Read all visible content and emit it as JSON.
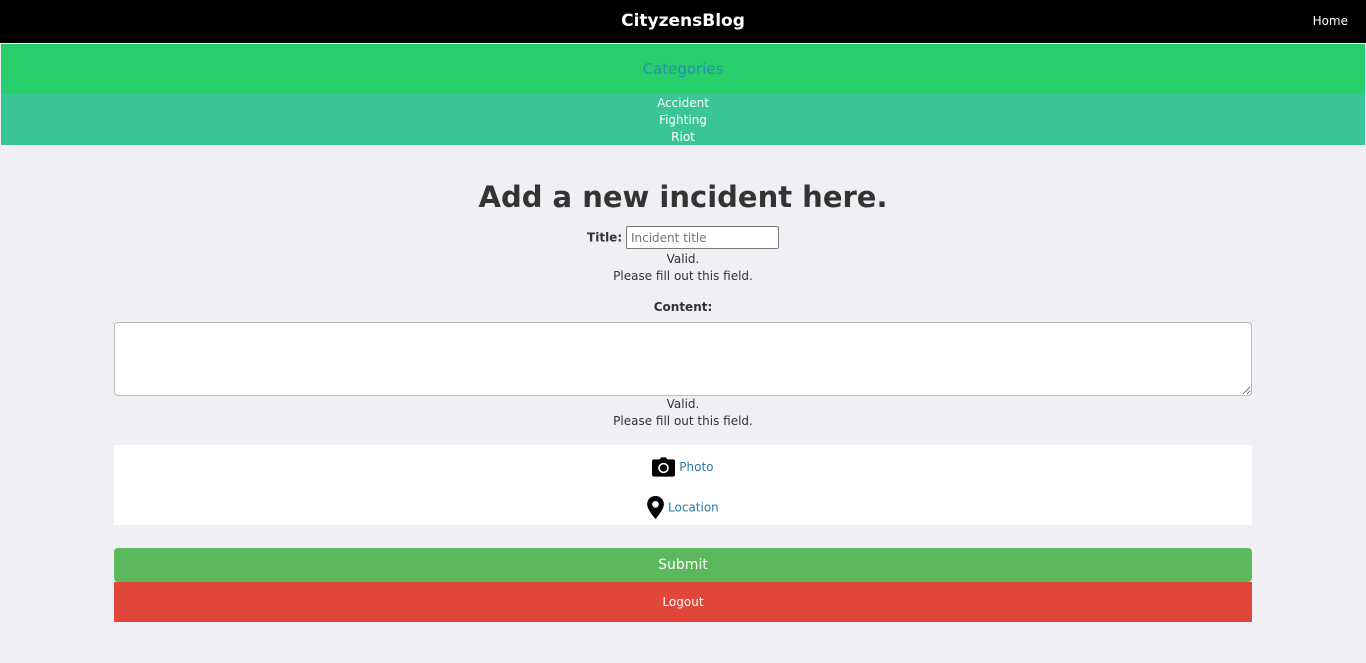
{
  "navbar": {
    "brand": "CityzensBlog",
    "home_link": "Home"
  },
  "categories": {
    "header": "Categories",
    "items": [
      "Accident",
      "Fighting",
      "Riot"
    ]
  },
  "form": {
    "heading": "Add a new incident here.",
    "title_label": "Title:",
    "title_placeholder": "Incident title",
    "title_value": "",
    "title_valid": "Valid.",
    "title_invalid": "Please fill out this field.",
    "content_label": "Content:",
    "content_value": "",
    "content_valid": "Valid.",
    "content_invalid": "Please fill out this field.",
    "photo_label": "Photo",
    "location_label": "Location",
    "submit_label": "Submit",
    "logout_label": "Logout"
  },
  "colors": {
    "navbar": "#000000",
    "categories_header": "#26cf6c",
    "categories_list": "#3ac596",
    "submit": "#5cb85c",
    "logout": "#e0463a"
  },
  "icons": {
    "photo": "camera-icon",
    "location": "map-pin-icon"
  }
}
